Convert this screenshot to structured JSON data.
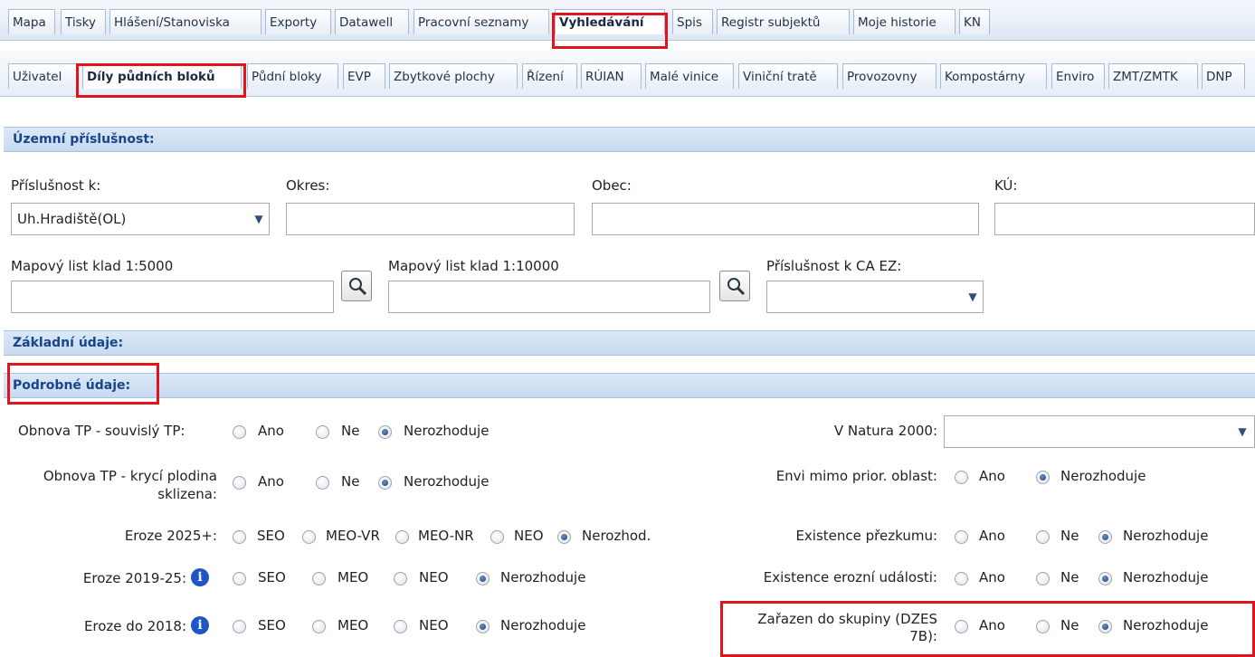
{
  "top_tabs": [
    "Mapa",
    "Tisky",
    "Hlášení/Stanoviska",
    "Exporty",
    "Datawell",
    "Pracovní seznamy",
    "Vyhledávání",
    "Spis",
    "Registr subjektů",
    "Moje historie",
    "KN"
  ],
  "sub_tabs": [
    "Uživatel",
    "Díly půdních bloků",
    "Půdní bloky",
    "EVP",
    "Zbytkové plochy",
    "Řízení",
    "RÚIAN",
    "Malé vinice",
    "Viniční tratě",
    "Provozovny",
    "Kompostárny",
    "Enviro",
    "ZMT/ZMTK",
    "DNP"
  ],
  "territory": {
    "header": "Územní příslušnost:",
    "prislusnost_label": "Příslušnost k:",
    "prislusnost_value": "Uh.Hradiště(OL)",
    "okres_label": "Okres:",
    "obec_label": "Obec:",
    "ku_label": "KÚ:",
    "map5000_label": "Mapový list klad 1:5000",
    "map10000_label": "Mapový list klad 1:10000",
    "ca_ez_label": "Příslušnost k CA EZ:"
  },
  "basic_header": "Základní údaje:",
  "detail_header": "Podrobné údaje:",
  "left_rows": [
    {
      "label": "Obnova TP - souvislý TP:",
      "options": [
        "Ano",
        "Ne",
        "Nerozhoduje"
      ],
      "selected": 2
    },
    {
      "label_line1": "Obnova TP - krycí plodina",
      "label_line2": "sklizena:",
      "options": [
        "Ano",
        "Ne",
        "Nerozhoduje"
      ],
      "selected": 2
    },
    {
      "label": "Eroze 2025+:",
      "options": [
        "SEO",
        "MEO-VR",
        "MEO-NR",
        "NEO",
        "Nerozhod."
      ],
      "selected": 4
    },
    {
      "label": "Eroze 2019-25:",
      "options": [
        "SEO",
        "MEO",
        "NEO",
        "Nerozhoduje"
      ],
      "selected": 3
    },
    {
      "label": "Eroze do 2018:",
      "options": [
        "SEO",
        "MEO",
        "NEO",
        "Nerozhoduje"
      ],
      "selected": 3
    }
  ],
  "right_rows": [
    {
      "label": "V Natura 2000:"
    },
    {
      "label": "Envi mimo prior. oblast:",
      "options": [
        "Ano",
        "Nerozhoduje"
      ],
      "selected": 1
    },
    {
      "label": "Existence přezkumu:",
      "options": [
        "Ano",
        "Ne",
        "Nerozhoduje"
      ],
      "selected": 2
    },
    {
      "label": "Existence erozní události:",
      "options": [
        "Ano",
        "Ne",
        "Nerozhoduje"
      ],
      "selected": 2
    },
    {
      "label_line1": "Zařazen do skupiny (DZES",
      "label_line2": "7B):",
      "options": [
        "Ano",
        "Ne",
        "Nerozhoduje"
      ],
      "selected": 2
    }
  ],
  "info_icon": "i",
  "colors": {
    "highlight": "#e0141c",
    "section_text": "#18448a",
    "radio_selected": "#1e3f7a"
  }
}
